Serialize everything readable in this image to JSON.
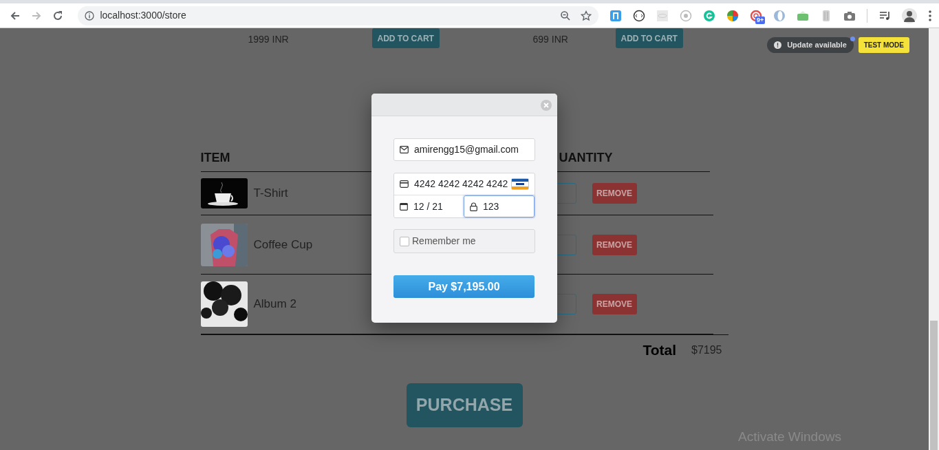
{
  "browser": {
    "url": "localhost:3000/store",
    "extension_badge": "9+"
  },
  "store_items": [
    {
      "price": "1999 INR",
      "button": "ADD TO CART"
    },
    {
      "price": "699 INR",
      "button": "ADD TO CART"
    }
  ],
  "notices": {
    "update": "Update available",
    "test_mode": "TEST MODE"
  },
  "cart": {
    "columns": [
      "ITEM",
      "UANTITY"
    ],
    "rows": [
      {
        "name": "T-Shirt",
        "remove": "REMOVE"
      },
      {
        "name": "Coffee Cup",
        "remove": "REMOVE"
      },
      {
        "name": "Album 2",
        "remove": "REMOVE"
      }
    ],
    "total_label": "Total",
    "total": "$7195"
  },
  "purchase_button": "PURCHASE",
  "checkout": {
    "email": "amirengg15@gmail.com",
    "card_number": "4242 4242 4242 4242",
    "expiry": "12 / 21",
    "cvc": "123",
    "cvc_focused": true,
    "remember": {
      "label": "Remember me",
      "checked": false
    },
    "pay_button": "Pay $7,195.00"
  },
  "os_notice": "Activate Windows"
}
